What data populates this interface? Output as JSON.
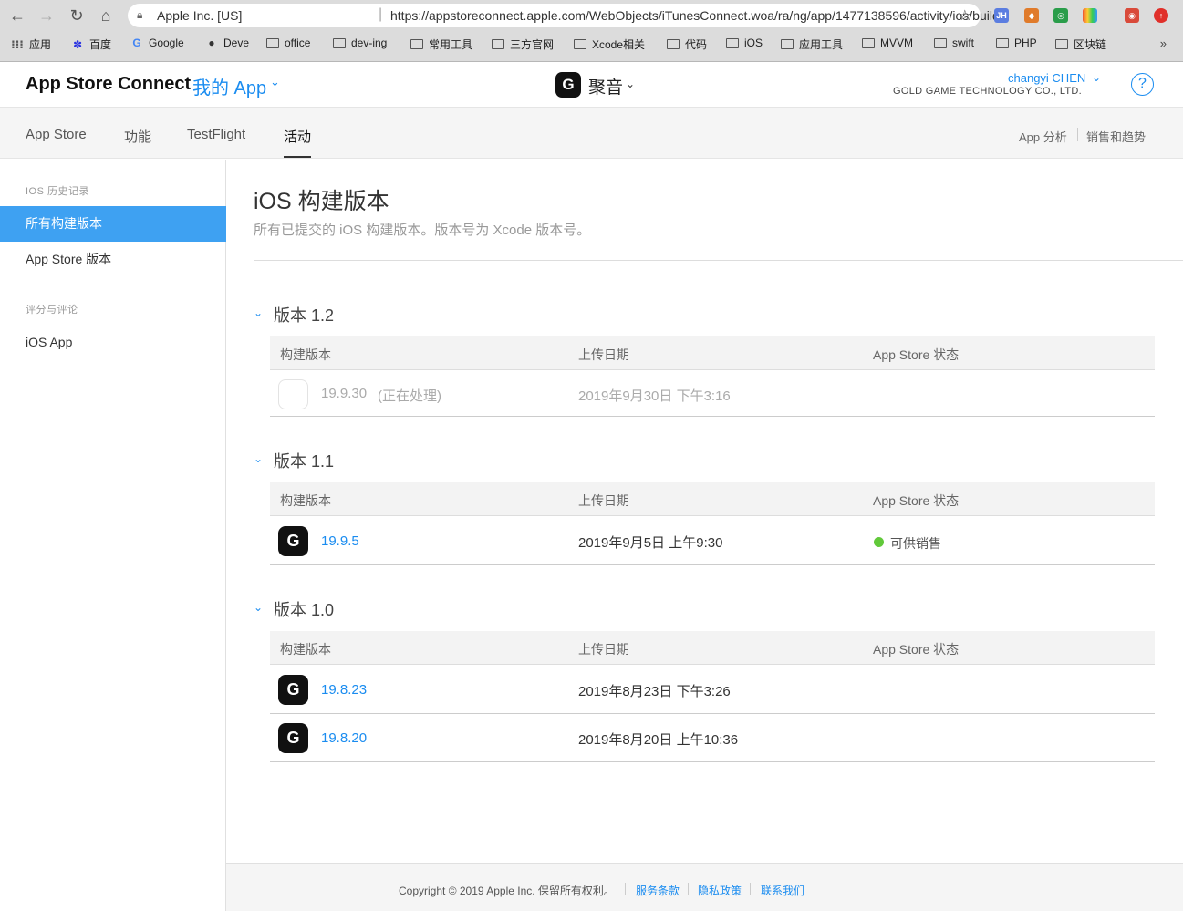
{
  "browser": {
    "url_org": "Apple Inc. [US]",
    "url": "https://appstoreconnect.apple.com/WebObjects/iTunesConnect.woa/ra/ng/app/1477138596/activity/ios/builds",
    "bookmarks": [
      "应用",
      "百度",
      "Google",
      "Deve",
      "office",
      "dev-ing",
      "常用工具",
      "三方官网",
      "Xcode相关",
      "代码",
      "iOS",
      "应用工具",
      "MVVM",
      "swift",
      "PHP",
      "区块链"
    ],
    "more": "»"
  },
  "header": {
    "brand": "App Store Connect",
    "my_apps": "我的 App",
    "app_name": "聚音",
    "user": "changyi CHEN",
    "company": "GOLD GAME TECHNOLOGY CO., LTD.",
    "help": "?"
  },
  "tabs": [
    {
      "label": "App Store"
    },
    {
      "label": "功能"
    },
    {
      "label": "TestFlight"
    },
    {
      "label": "活动"
    }
  ],
  "right_links": [
    "App 分析",
    "销售和趋势"
  ],
  "sidebar": {
    "section1": "IOS 历史记录",
    "items1": [
      "所有构建版本",
      "App Store 版本"
    ],
    "section2": "评分与评论",
    "items2": [
      "iOS App"
    ]
  },
  "main": {
    "title": "iOS 构建版本",
    "subtitle": "所有已提交的 iOS 构建版本。版本号为 Xcode 版本号。",
    "columns": [
      "构建版本",
      "上传日期",
      "App Store 状态"
    ],
    "versions": [
      {
        "title": "版本 1.2",
        "rows": [
          {
            "build": "19.9.30",
            "note": "(正在处理)",
            "date": "2019年9月30日 下午3:16",
            "status": ""
          }
        ]
      },
      {
        "title": "版本 1.1",
        "rows": [
          {
            "build": "19.9.5",
            "note": "",
            "date": "2019年9月5日 上午9:30",
            "status": "可供销售"
          }
        ]
      },
      {
        "title": "版本 1.0",
        "rows": [
          {
            "build": "19.8.23",
            "note": "",
            "date": "2019年8月23日 下午3:26",
            "status": ""
          },
          {
            "build": "19.8.20",
            "note": "",
            "date": "2019年8月20日 上午10:36",
            "status": ""
          }
        ]
      }
    ]
  },
  "footer": {
    "copyright": "Copyright © 2019 Apple Inc. 保留所有权利。",
    "links": [
      "服务条款",
      "隐私政策",
      "联系我们"
    ]
  },
  "colors": {
    "accent": "#1a8cf0",
    "sidebar_active": "#3ea1f2",
    "status_available": "#61c93a"
  }
}
